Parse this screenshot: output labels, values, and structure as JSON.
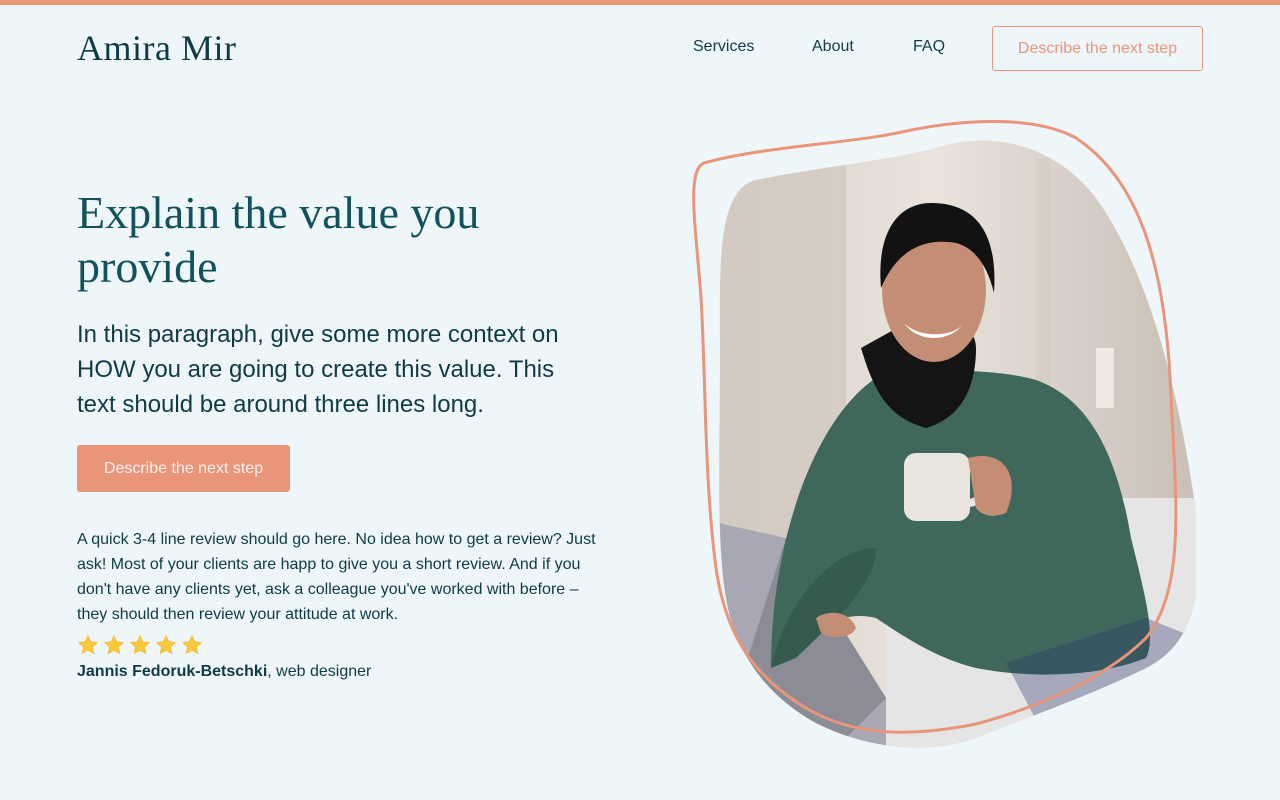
{
  "header": {
    "logo": "Amira Mir",
    "nav": [
      "Services",
      "About",
      "FAQ"
    ],
    "cta_label": "Describe the next step"
  },
  "hero": {
    "title": "Explain the value you provide",
    "text": "In this paragraph, give some more context on HOW you are going to create this value. This text should be around three lines long.",
    "cta_label": "Describe the next step"
  },
  "review": {
    "text": "A quick 3-4 line review should go here. No idea how to get a review? Just ask! Most of your clients are happ to give you a short review. And if you don't have any clients yet, ask a colleague you've worked with before – they should then review your attitude at work.",
    "stars": 5,
    "author": "Jannis Fedoruk-Betschki",
    "author_role": ", web designer"
  },
  "colors": {
    "accent": "#e8957a",
    "background": "#eef6f9",
    "heading": "#12525a",
    "text": "#0f3b44",
    "star": "#f8c93d"
  },
  "icons": {
    "star": "star-icon"
  }
}
